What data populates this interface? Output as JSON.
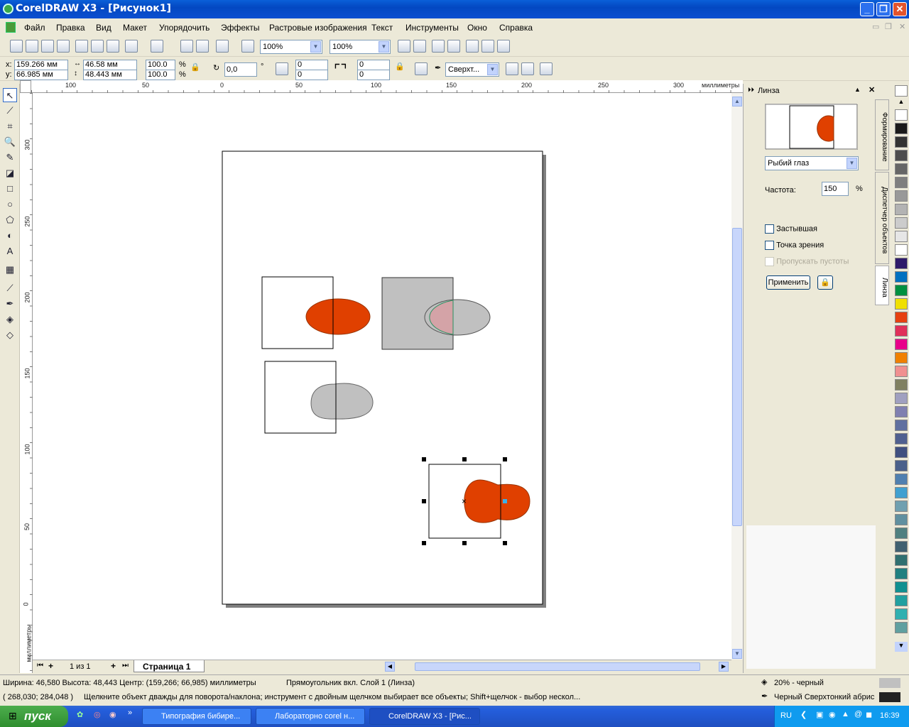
{
  "window": {
    "title": "CorelDRAW X3 - [Рисунок1]"
  },
  "menu": [
    "Файл",
    "Правка",
    "Вид",
    "Макет",
    "Упорядочить",
    "Эффекты",
    "Растровые изображения",
    "Текст",
    "Инструменты",
    "Окно",
    "Справка"
  ],
  "toolbar": {
    "zoom1": "100%",
    "zoom2": "100%"
  },
  "property": {
    "x": "159.266 мм",
    "y": "66.985 мм",
    "w": "46.58 мм",
    "h": "48.443 мм",
    "sx": "100.0",
    "sy": "100.0",
    "pct": "%",
    "rot": "0,0",
    "deg": "°",
    "c1": "0",
    "c2": "0",
    "c3": "0",
    "c4": "0",
    "outline": "Сверхт..."
  },
  "rulers": {
    "unit": "миллиметры",
    "h": [
      "100",
      "50",
      "0",
      "50",
      "100",
      "150",
      "200",
      "250",
      "300"
    ],
    "v": [
      "300",
      "250",
      "200",
      "150",
      "100",
      "50",
      "0"
    ]
  },
  "pages": {
    "counter": "1 из 1",
    "tab": "Страница 1"
  },
  "docker": {
    "title": "Линза",
    "lens_type": "Рыбий глаз",
    "freq_label": "Частота:",
    "freq_value": "150",
    "freq_unit": "%",
    "frozen": "Застывшая",
    "viewpoint": "Точка зрения",
    "skip": "Пропускать пустоты",
    "apply": "Применить",
    "tabs": [
      "Формирование",
      "Диспетчер объектов",
      "Линза"
    ]
  },
  "palette": {
    "colors": [
      "#ffffff",
      "#1a1a1a",
      "#333333",
      "#4d4d4d",
      "#666666",
      "#7f7f7f",
      "#999999",
      "#b3b3b3",
      "#cccccc",
      "#e6e6e6",
      "#ffffff",
      "#2e1a6a",
      "#0070c0",
      "#009040",
      "#f0e000",
      "#e64010",
      "#e0305a",
      "#e8008a",
      "#f08000",
      "#f09090",
      "#808060",
      "#a0a0c0",
      "#8080b0",
      "#6070a0",
      "#506090",
      "#405080",
      "#4a608a",
      "#5080b0",
      "#40a0d0",
      "#70a0b0",
      "#6090a0",
      "#508080",
      "#406070",
      "#307070",
      "#208080",
      "#109090",
      "#20a0a0",
      "#30b0b0",
      "#60a0a0"
    ]
  },
  "status": {
    "line1": "Ширина: 46,580  Высота: 48,443  Центр: (159,266; 66,985)  миллиметры",
    "line1b": "Прямоугольник вкл. Слой 1  (Линза)",
    "line2": "( 268,030; 284,048 )",
    "line2b": "Щелкните объект дважды для поворота/наклона; инструмент с двойным щелчком выбирает все объекты; Shift+щелчок - выбор нескол...",
    "fill": "20% - черный",
    "outline": "Черный  Сверхтонкий абрис"
  },
  "taskbar": {
    "start": "пуск",
    "tasks": [
      "Типография бибире...",
      "Лабораторно corel н...",
      "CorelDRAW X3 - [Рис..."
    ],
    "lang": "RU",
    "time": "16:39"
  }
}
